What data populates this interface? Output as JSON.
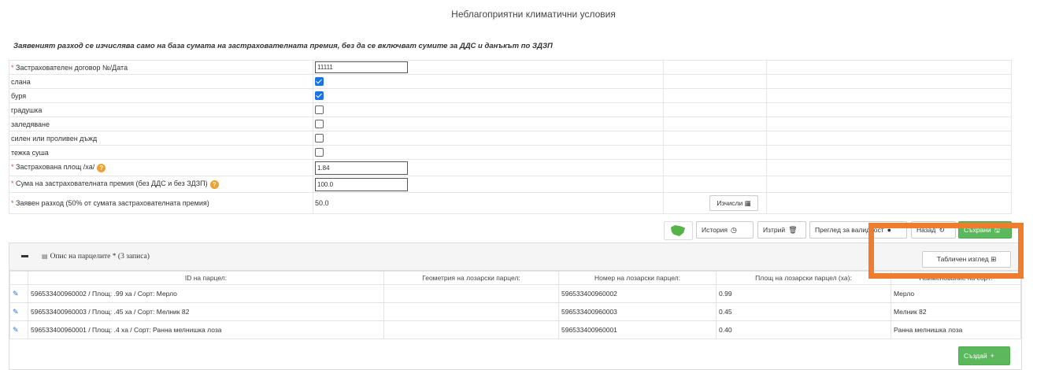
{
  "page": {
    "title": "Неблагоприятни климатични условия",
    "notice": "Заявеният разход се изчислява само на база сумата на застрахователната премия, без да се включват сумите за ДДС и данъкът по ЗДЗП"
  },
  "form": {
    "contract_label": "Застрахователен договор №/Дата",
    "contract_value": "11111",
    "hazards": [
      {
        "label": "слана",
        "checked": true
      },
      {
        "label": "буря",
        "checked": true
      },
      {
        "label": "градушка",
        "checked": false
      },
      {
        "label": "заледяване",
        "checked": false
      },
      {
        "label": "силен или проливен дъжд",
        "checked": false
      },
      {
        "label": "тежка суша",
        "checked": false
      }
    ],
    "area_label": "Застрахована площ /ха/",
    "area_value": "1.84",
    "premium_label": "Сума на застрахователната премия (без ДДС и без ЗДЗП)",
    "premium_value": "100.0",
    "claimed_label": "Заявен разход (50% от сумата застрахователната премия)",
    "claimed_value": "50.0",
    "required_mark": "*",
    "help_glyph": "?",
    "calc_button": "Изчисли",
    "calc_icon_glyph": "▦"
  },
  "toolbar": {
    "history": "История",
    "history_icon": "◷",
    "delete": "Изтрий",
    "delete_icon": "🗑",
    "validity": "Преглед за валидност",
    "validity_icon": "●",
    "back": "Назад",
    "back_icon": "↻",
    "save": "Съхрани",
    "save_icon": "🖫"
  },
  "parcels_panel": {
    "title": "Опис на парцелите * (3 записа)",
    "grid_icon": "▤",
    "table_view_button": "Табличен изглед",
    "table_view_icon": "⊞",
    "columns": [
      "ID на парцел:",
      "Геометрия на лозарски парцел:",
      "Номер на лозарски парцел:",
      "Площ на лозарски парцел (ха):",
      "Наименование на сорт:"
    ],
    "rows": [
      {
        "id": "596533400960002 / Площ: .99 ха / Сорт: Мерло",
        "geometry": "",
        "number": "596533400960002",
        "area": "0.99",
        "variety": "Мерло"
      },
      {
        "id": "596533400960003 / Площ: .45 ха / Сорт: Мелник 82",
        "geometry": "",
        "number": "596533400960003",
        "area": "0.45",
        "variety": "Мелник 82"
      },
      {
        "id": "596533400960001 / Площ: .4 ха / Сорт: Ранна мелнишка лоза",
        "geometry": "",
        "number": "596533400960001",
        "area": "0.40",
        "variety": "Ранна мелнишка лоза"
      }
    ],
    "edit_icon_glyph": "✎",
    "create_button": "Създай",
    "create_icon": "+"
  },
  "colors": {
    "accent_green": "#5cb85c",
    "checkbox_blue": "#1a73e8",
    "highlight_orange": "#f07c2e",
    "required_red": "#e74c3c"
  }
}
